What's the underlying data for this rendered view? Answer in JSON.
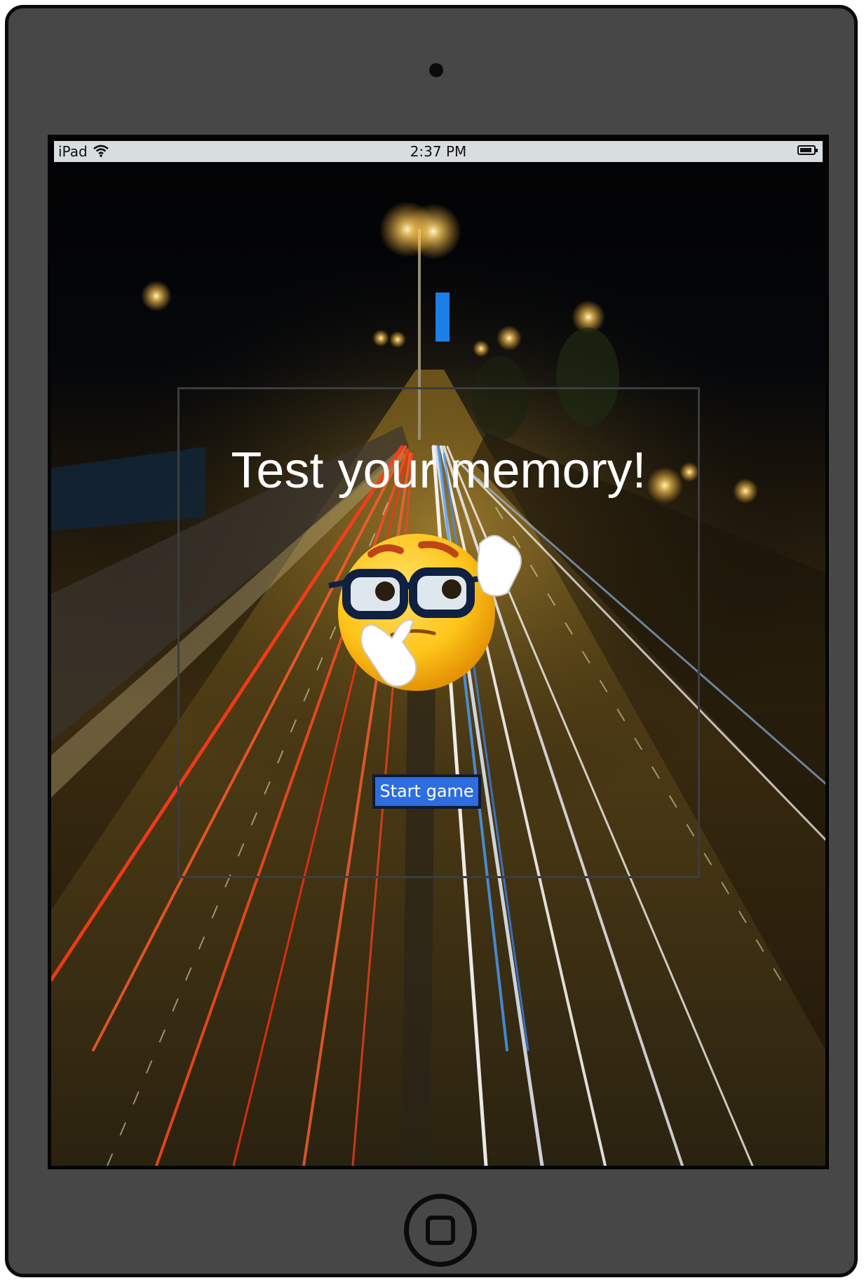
{
  "status_bar": {
    "carrier": "iPad",
    "time": "2:37 PM"
  },
  "game": {
    "title": "Test your memory!",
    "start_button": "Start game"
  },
  "icons": [
    "camera-icon",
    "wifi-icon",
    "battery-icon",
    "thinking-emoji-icon",
    "home-button-icon"
  ],
  "colors": {
    "device_body": "#474747",
    "status_bar": "#d8dde0",
    "start_button": "#2d6de0",
    "title_text": "#ffffff"
  }
}
